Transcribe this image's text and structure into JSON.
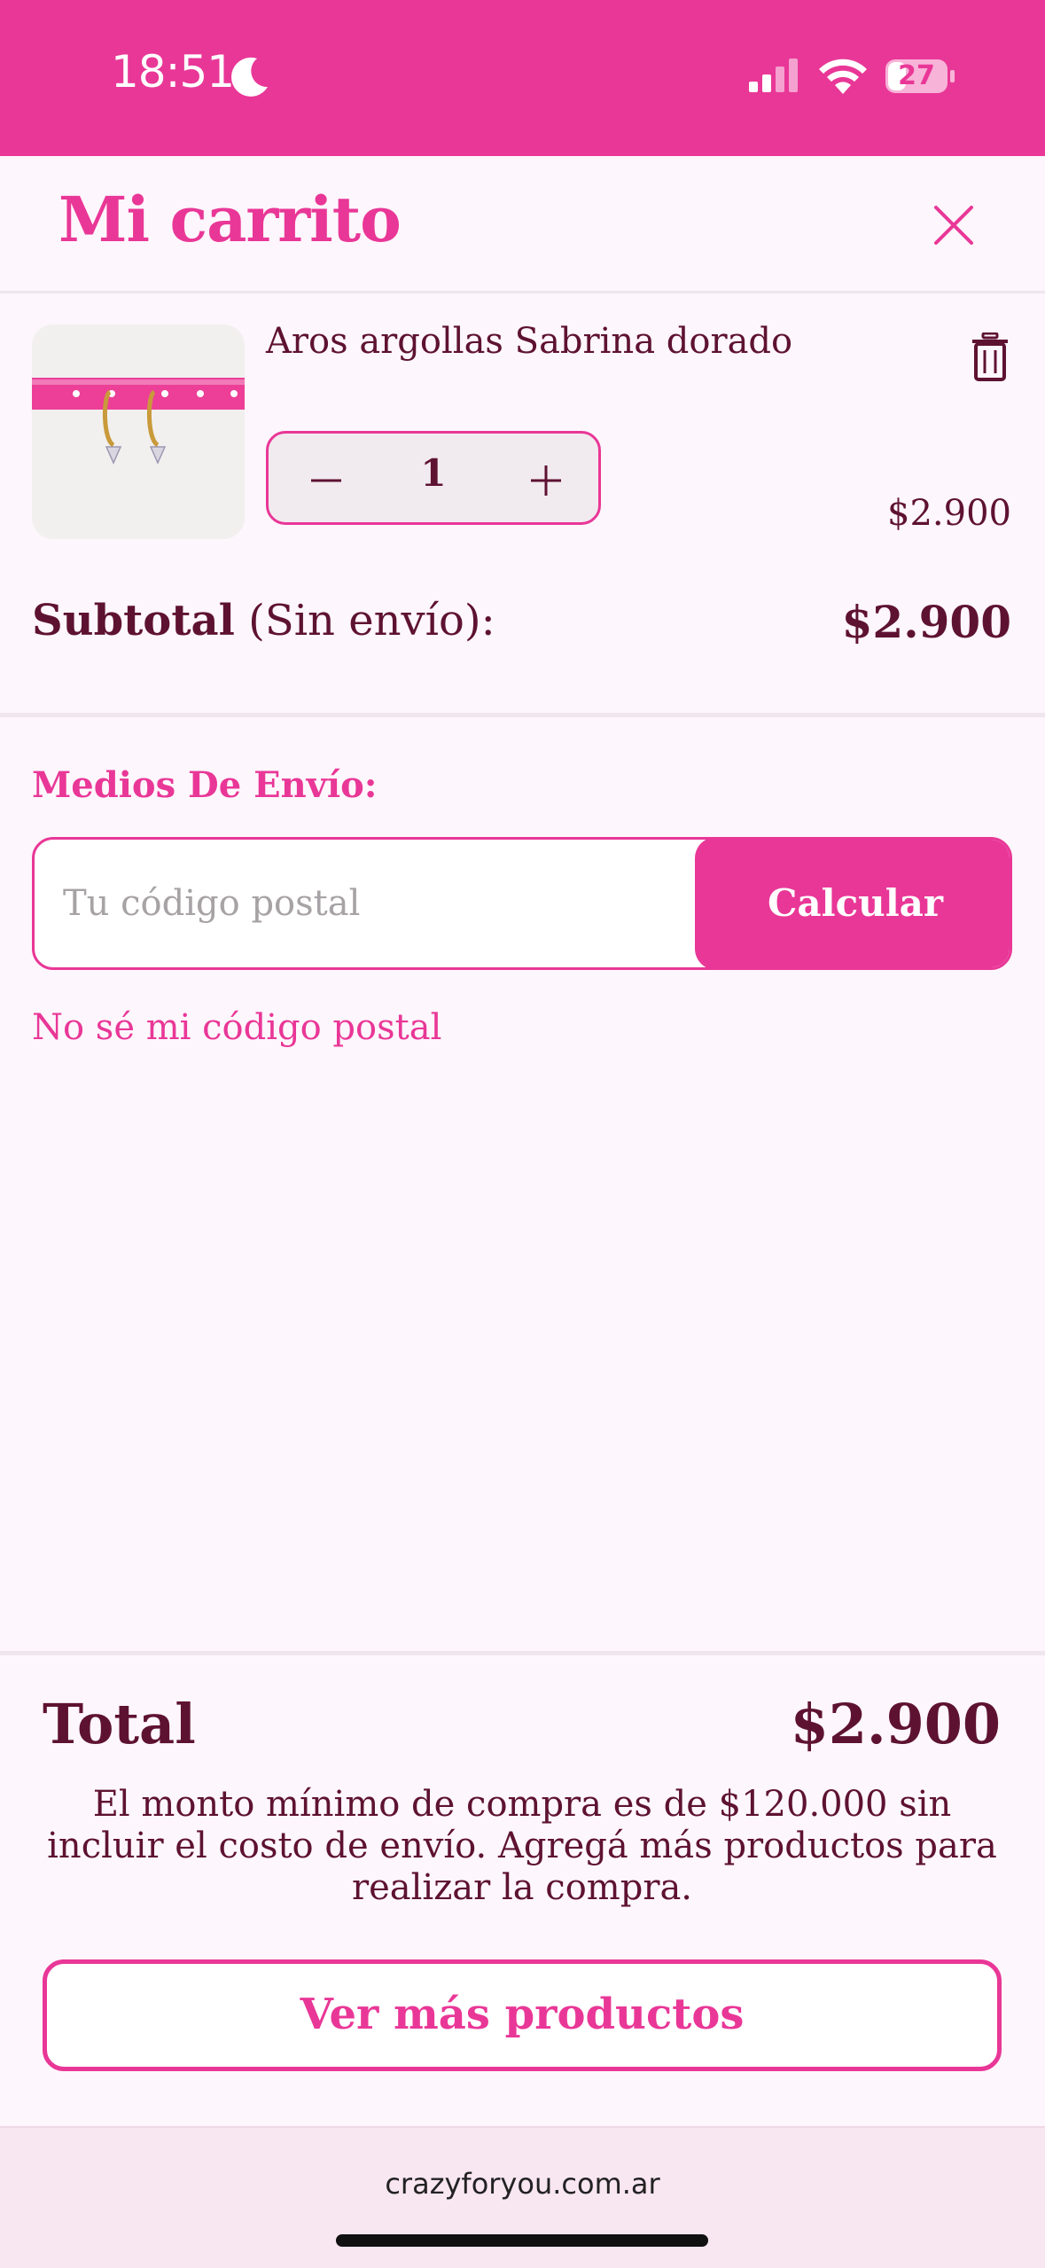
{
  "status_bar": {
    "time": "18:51",
    "battery": "27",
    "moon_icon": "moon-icon",
    "signal_icon": "cellular-signal-icon",
    "wifi_icon": "wifi-icon",
    "battery_icon": "battery-icon"
  },
  "header": {
    "title": "Mi carrito",
    "close_icon": "close-icon"
  },
  "cart": {
    "items": [
      {
        "name": "Aros argollas Sabrina dorado",
        "quantity": "1",
        "price": "$2.900",
        "image_icon": "earrings-product-image",
        "delete_icon": "trash-icon"
      }
    ],
    "subtotal_label_bold": "Subtotal",
    "subtotal_label_rest": " (Sin envío):",
    "subtotal_value": "$2.900"
  },
  "shipping": {
    "title": "Medios De Envío:",
    "postal_placeholder": "Tu código postal",
    "calculate_label": "Calcular",
    "unknown_postal_link": "No sé mi código postal"
  },
  "totals": {
    "total_label": "Total",
    "total_value": "$2.900",
    "min_purchase_note": "El monto mínimo de compra es de $120.000 sin incluir el costo de envío. Agregá más productos para realizar la compra.",
    "more_products_label": "Ver más productos"
  },
  "browser": {
    "url": "crazyforyou.com.ar"
  },
  "colors": {
    "accent": "#e93797",
    "text": "#5e1232",
    "background": "#fdf6fc"
  }
}
